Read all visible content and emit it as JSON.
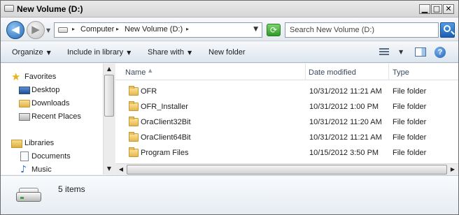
{
  "window": {
    "title": "New Volume (D:)",
    "controls": {
      "minimize": "▁",
      "maximize": "□",
      "close": "✕"
    }
  },
  "address_bar": {
    "breadcrumbs": [
      "Computer",
      "New Volume (D:)"
    ],
    "drive_icon": "drive-icon",
    "refresh_icon": "refresh-icon"
  },
  "search": {
    "placeholder": "Search New Volume (D:)",
    "icon": "search-icon"
  },
  "toolbar": {
    "organize_label": "Organize",
    "include_label": "Include in library",
    "share_label": "Share with",
    "new_folder_label": "New folder",
    "help_label": "?"
  },
  "nav_pane": {
    "favorites_label": "Favorites",
    "favorites": [
      "Desktop",
      "Downloads",
      "Recent Places"
    ],
    "libraries_label": "Libraries",
    "libraries": [
      "Documents",
      "Music"
    ]
  },
  "file_list": {
    "columns": [
      "Name",
      "Date modified",
      "Type"
    ],
    "rows": [
      {
        "name": "OFR",
        "date_modified": "10/31/2012 11:21 AM",
        "type": "File folder"
      },
      {
        "name": "OFR_Installer",
        "date_modified": "10/31/2012 1:00 PM",
        "type": "File folder"
      },
      {
        "name": "OraClient32Bit",
        "date_modified": "10/31/2012 11:20 AM",
        "type": "File folder"
      },
      {
        "name": "OraClient64Bit",
        "date_modified": "10/31/2012 11:21 AM",
        "type": "File folder"
      },
      {
        "name": "Program Files",
        "date_modified": "10/15/2012 3:50 PM",
        "type": "File folder"
      }
    ]
  },
  "details_pane": {
    "item_count": "5 items"
  },
  "colors": {
    "accent": "#2469b3",
    "folder": "#e5b84f",
    "header_text": "#3a4a5e"
  }
}
